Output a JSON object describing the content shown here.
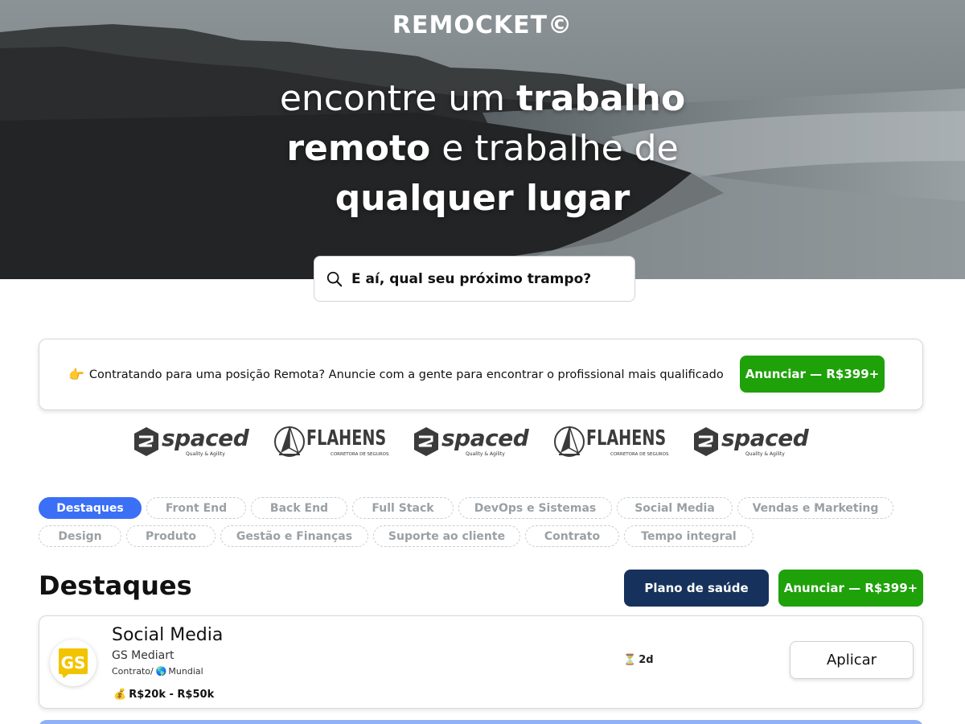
{
  "brand": {
    "logo": "REMOCKET©"
  },
  "hero": {
    "line1_light": "encontre um ",
    "line1_bold": "trabalho",
    "line2_bold": "remoto",
    "line2_light": " e trabalhe de",
    "line3_bold": "qualquer lugar"
  },
  "search": {
    "placeholder": "E aí, qual seu próximo trampo?",
    "icon": "search-icon"
  },
  "banner": {
    "emoji": "👉",
    "text": "Contratando para uma posição Remota? Anuncie com a gente para encontrar o profissional mais qualificado",
    "button": "Anunciar — R$399+"
  },
  "sponsors": {
    "spaced_name": "spaced",
    "spaced_tag": "Quality & Agility",
    "flahens_name": "FLAHENS",
    "flahens_tag": "CORRETORA DE SEGUROS"
  },
  "filters": [
    "Destaques",
    "Front End",
    "Back End",
    "Full Stack",
    "DevOps e Sistemas",
    "Social Media",
    "Vendas e Marketing",
    "Design",
    "Produto",
    "Gestão e Finanças",
    "Suporte ao cliente",
    "Contrato",
    "Tempo integral"
  ],
  "active_filter": "Destaques",
  "section": {
    "title": "Destaques",
    "health_button": "Plano de saúde",
    "advertise_button": "Anunciar — R$399+"
  },
  "jobs": [
    {
      "logo_text": "GS",
      "title": "Social Media",
      "company": "GS Mediart",
      "contract": "Contrato/",
      "globe": "🌎",
      "location": "Mundial",
      "salary_icon": "💰",
      "salary": "R$20k - R$50k",
      "time_icon": "⏳",
      "posted": "2d",
      "apply": "Aplicar"
    }
  ],
  "colors": {
    "accent_blue": "#3b6ff5",
    "green": "#1fa10a",
    "navy": "#16325c"
  }
}
